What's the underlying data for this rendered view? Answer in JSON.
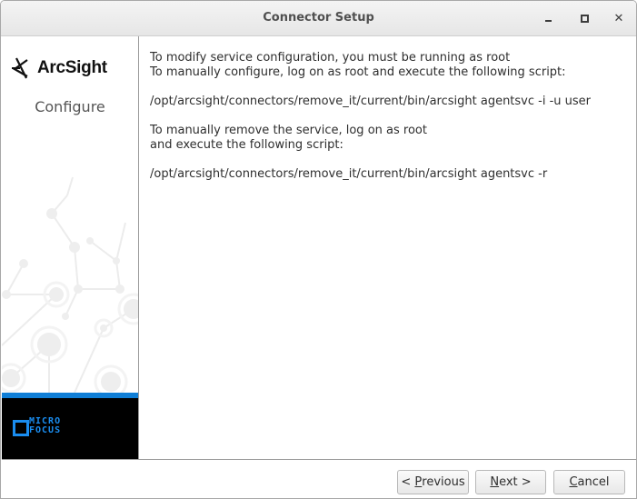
{
  "window": {
    "title": "Connector Setup",
    "controls": {
      "minimize": "_",
      "maximize": "□",
      "close": "✕"
    }
  },
  "sidebar": {
    "logo_text": "ArcSight",
    "step_label": "Configure",
    "vendor_line1": "MICRO",
    "vendor_line2": "FOCUS",
    "accent_color": "#0f7ed6"
  },
  "main": {
    "lines": [
      "To modify service configuration, you must be running as root",
      "To manually configure, log on as root and execute the following script:",
      "",
      "/opt/arcsight/connectors/remove_it/current/bin/arcsight agentsvc -i -u user",
      "",
      "To manually remove the service, log on as root",
      "and execute the following script:",
      "",
      "/opt/arcsight/connectors/remove_it/current/bin/arcsight agentsvc -r"
    ]
  },
  "footer": {
    "previous": {
      "prefix": "< ",
      "mnemonic": "P",
      "rest": "revious"
    },
    "next": {
      "mnemonic": "N",
      "rest": "ext >"
    },
    "cancel": {
      "mnemonic": "C",
      "rest": "ancel"
    }
  }
}
